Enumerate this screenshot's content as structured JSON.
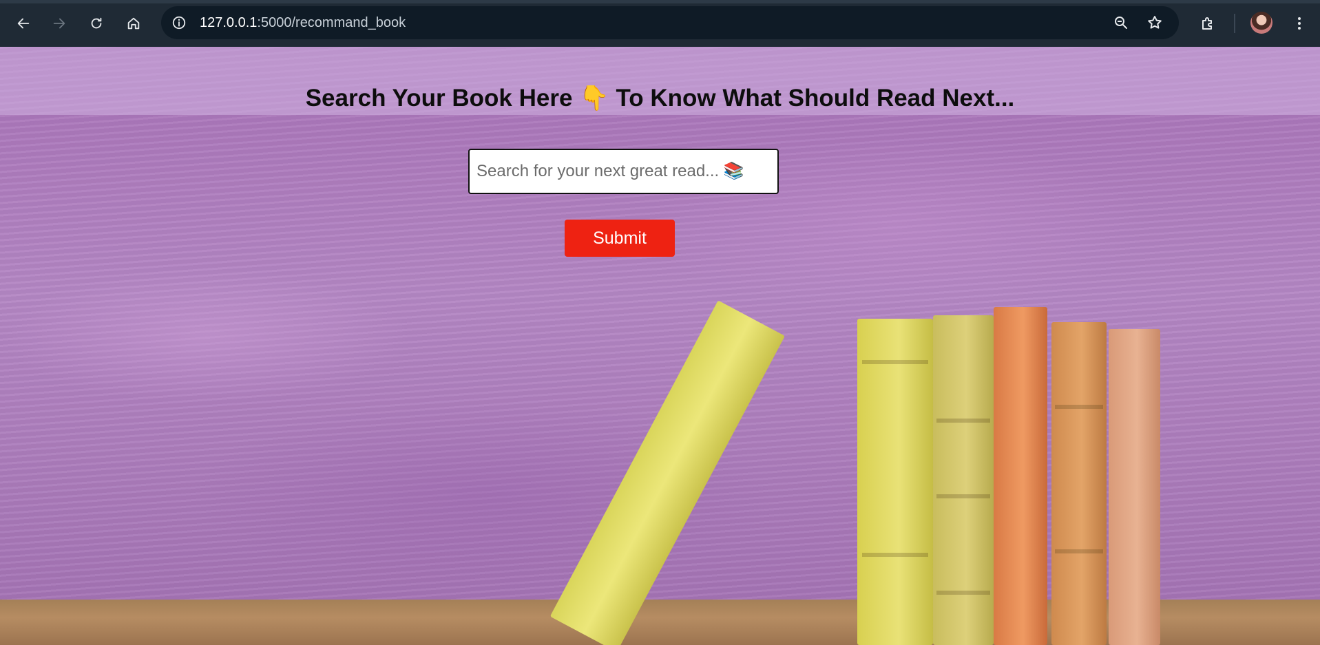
{
  "browser": {
    "url_host": "127.0.0.1",
    "url_path": ":5000/recommand_book",
    "nav_icons": [
      "back-arrow-icon",
      "forward-arrow-icon",
      "reload-icon",
      "home-icon"
    ],
    "omnibox_icons": [
      "site-info-icon",
      "zoom-icon",
      "bookmark-star-icon"
    ],
    "toolbar_icons": [
      "extensions-icon",
      "avatar",
      "more-menu-icon"
    ]
  },
  "page": {
    "heading_before": "Search Your Book Here",
    "heading_emoji": "👇",
    "heading_after": "To Know What Should Read Next...",
    "search": {
      "placeholder": "Search for your next great read... 📚",
      "value": ""
    },
    "submit_label": "Submit",
    "colors": {
      "submit": "#ee2212",
      "background": "#ad7fbe",
      "heading_band": "#d2b4e1"
    }
  }
}
